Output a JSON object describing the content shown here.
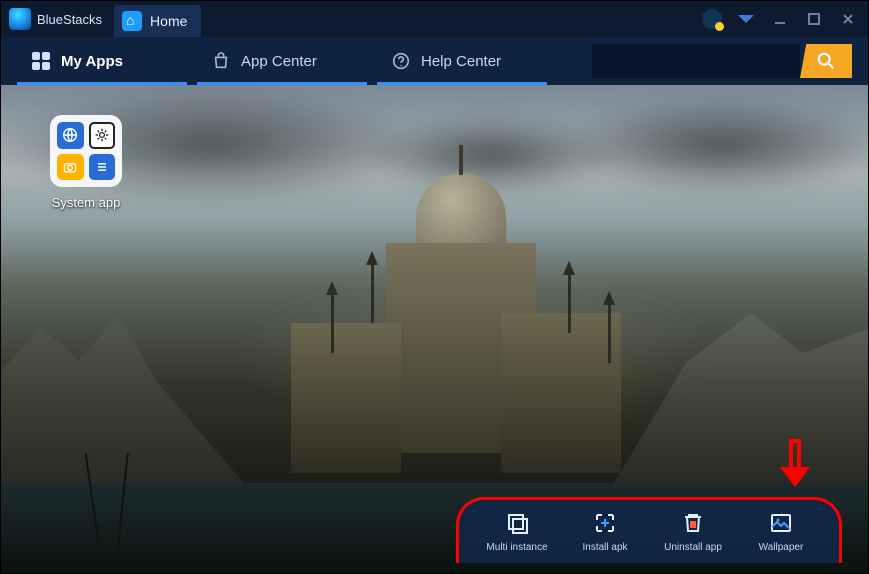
{
  "app_name": "BlueStacks",
  "tabs": [
    {
      "label": "Home"
    }
  ],
  "nav": {
    "my_apps": "My Apps",
    "app_center": "App Center",
    "help_center": "Help Center"
  },
  "search": {
    "placeholder": ""
  },
  "desktop": {
    "system_app_label": "System app"
  },
  "tray": {
    "multi_instance": "Multi instance",
    "install_apk": "Install apk",
    "uninstall_app": "Uninstall app",
    "wallpaper": "Wallpaper"
  }
}
